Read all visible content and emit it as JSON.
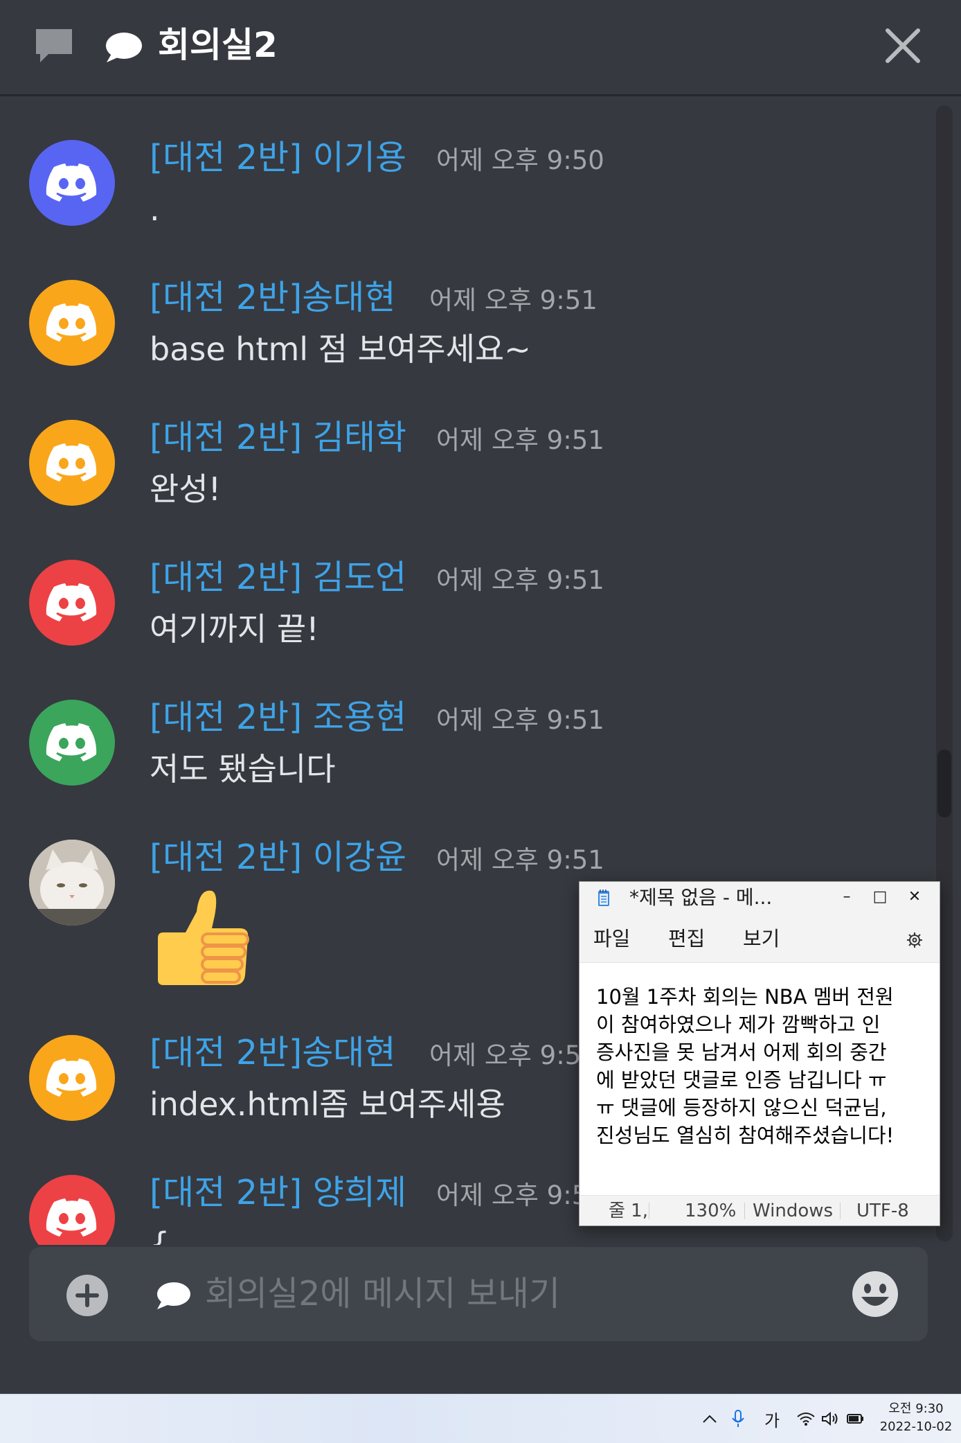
{
  "header": {
    "channel_title": "회의실2",
    "icons": [
      "threads-icon",
      "chat-bubble-icon",
      "close-icon"
    ]
  },
  "messages": [
    {
      "author": "[대전 2반] 이기용",
      "time": "어제 오후 9:50",
      "text": ".",
      "avatar_color": "#5865f2",
      "avatar": "discord-logo-icon"
    },
    {
      "author": "[대전 2반]송대현",
      "time": "어제 오후 9:51",
      "text": "base html 점 보여주세요~",
      "avatar_color": "#faa61a",
      "avatar": "discord-logo-icon"
    },
    {
      "author": "[대전 2반] 김태학",
      "time": "어제 오후 9:51",
      "text": "완성!",
      "avatar_color": "#faa61a",
      "avatar": "discord-logo-icon"
    },
    {
      "author": "[대전 2반] 김도언",
      "time": "어제 오후 9:51",
      "text": "여기까지 끝!",
      "avatar_color": "#ed4245",
      "avatar": "discord-logo-icon"
    },
    {
      "author": "[대전 2반] 조용현",
      "time": "어제 오후 9:51",
      "text": "저도 됐습니다",
      "avatar_color": "#3ba55c",
      "avatar": "discord-logo-icon"
    },
    {
      "author": "[대전 2반] 이강윤",
      "time": "어제 오후 9:51",
      "text": "",
      "avatar_color": "#d9d4cc",
      "avatar": "cat-photo-avatar",
      "emoji": "thumbs-up-icon"
    },
    {
      "author": "[대전 2반]송대현",
      "time": "어제 오후 9:5",
      "text": "index.html좀 보여주세용",
      "avatar_color": "#faa61a",
      "avatar": "discord-logo-icon"
    },
    {
      "author": "[대전 2반] 양희제",
      "time": "어제 오후 9:5",
      "text": "{",
      "avatar_color": "#ed4245",
      "avatar": "discord-logo-icon"
    }
  ],
  "composer": {
    "placeholder": "회의실2에 메시지 보내기",
    "icons": [
      "plus-circle-icon",
      "chat-bubble-icon",
      "emoji-smile-icon"
    ]
  },
  "notepad": {
    "title": "*제목 없음 - 메...",
    "window_controls": [
      "minimize-icon",
      "maximize-icon",
      "close-icon"
    ],
    "menu": [
      "파일",
      "편집",
      "보기"
    ],
    "content": "10월 1주차 회의는 NBA 멤버 전원\n이 참여하였으나 제가 깜빡하고 인\n증사진을 못 남겨서 어제 회의 중간\n에 받았던 댓글로 인증 남깁니다 ㅠ\nㅠ 댓글에 등장하지 않으신 덕균님,\n진성님도 열심히 참여해주셨습니다!",
    "status": {
      "position": "줄 1, ",
      "zoom": "130%",
      "line_ending": "Windows",
      "encoding": "UTF-8"
    }
  },
  "taskbar": {
    "tray_icons": [
      "chevron-up-icon",
      "microphone-icon",
      "ime-icon",
      "wifi-icon",
      "speaker-icon",
      "battery-icon"
    ],
    "ime_label": "가",
    "clock_time": "오전 9:30",
    "clock_date": "2022-10-02"
  }
}
